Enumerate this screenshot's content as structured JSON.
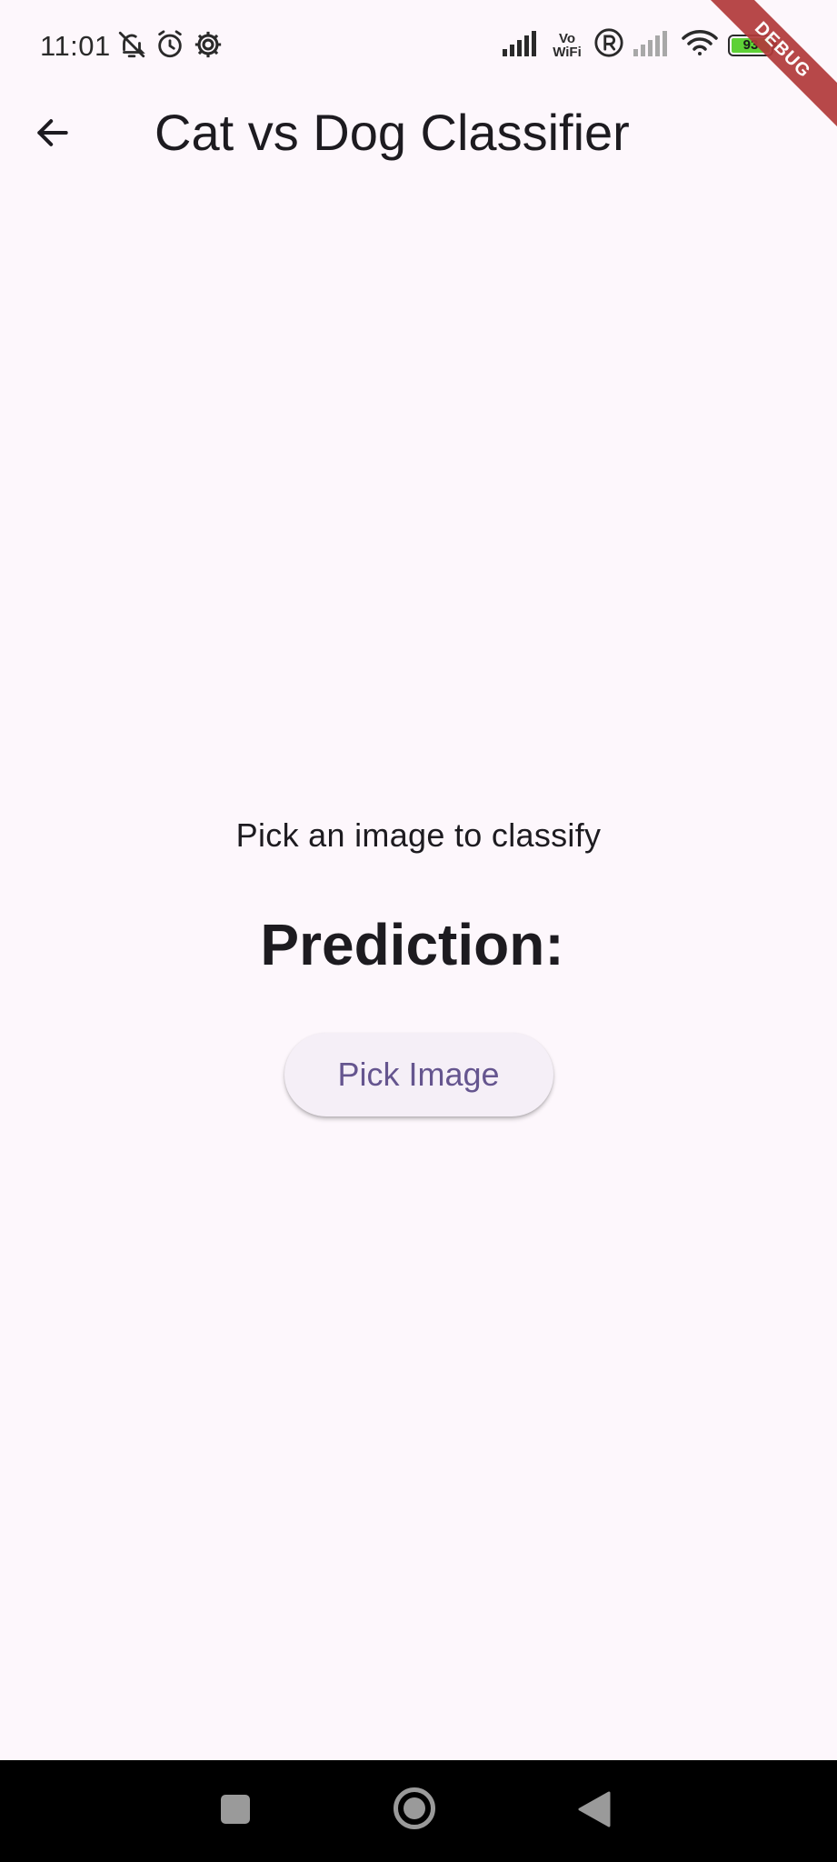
{
  "status_bar": {
    "time": "11:01",
    "left_icons": [
      "bell-off-icon",
      "alarm-icon",
      "settings-gear-icon"
    ],
    "right_icons": [
      "signal-icon",
      "vowifi-icon",
      "roaming-icon",
      "signal-weak-icon",
      "wifi-icon",
      "battery-icon"
    ],
    "vowifi_top": "Vo",
    "vowifi_bottom": "WiFi",
    "battery_level": "93",
    "battery_color": "#5ed136"
  },
  "debug_banner": "DEBUG",
  "app_bar": {
    "back_icon": "arrow-back-icon",
    "title": "Cat vs Dog Classifier"
  },
  "main": {
    "hint": "Pick an image to classify",
    "prediction_label": "Prediction:",
    "pick_button_label": "Pick Image"
  },
  "nav_bar": {
    "items": [
      "recent-apps-icon",
      "home-icon",
      "back-triangle-icon"
    ]
  },
  "colors": {
    "background": "#fdf7fc",
    "primary": "#65558f",
    "button_surface": "#f5eff7",
    "debug_ribbon": "#b23a3a"
  }
}
